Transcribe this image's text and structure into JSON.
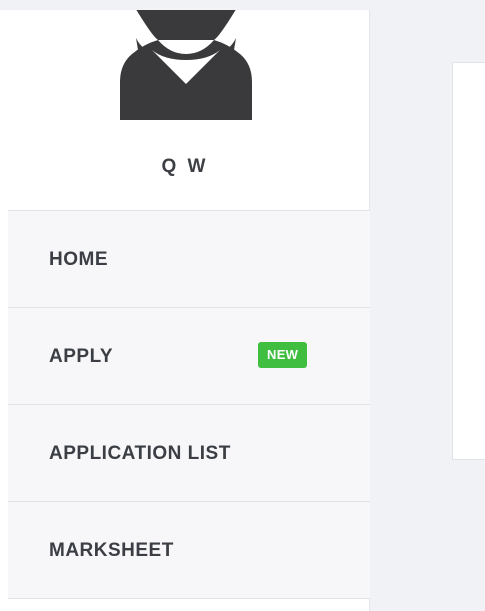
{
  "user": {
    "name": "Q W"
  },
  "icons": {
    "avatar": "female-avatar-icon"
  },
  "colors": {
    "badge_bg": "#3fbe3f",
    "menu_text": "#3b3e44",
    "avatar_fill": "#3a3a3c"
  },
  "menu": {
    "items": [
      {
        "label": "HOME"
      },
      {
        "label": "APPLY",
        "badge": "NEW"
      },
      {
        "label": "APPLICATION LIST"
      },
      {
        "label": "MARKSHEET"
      }
    ]
  }
}
